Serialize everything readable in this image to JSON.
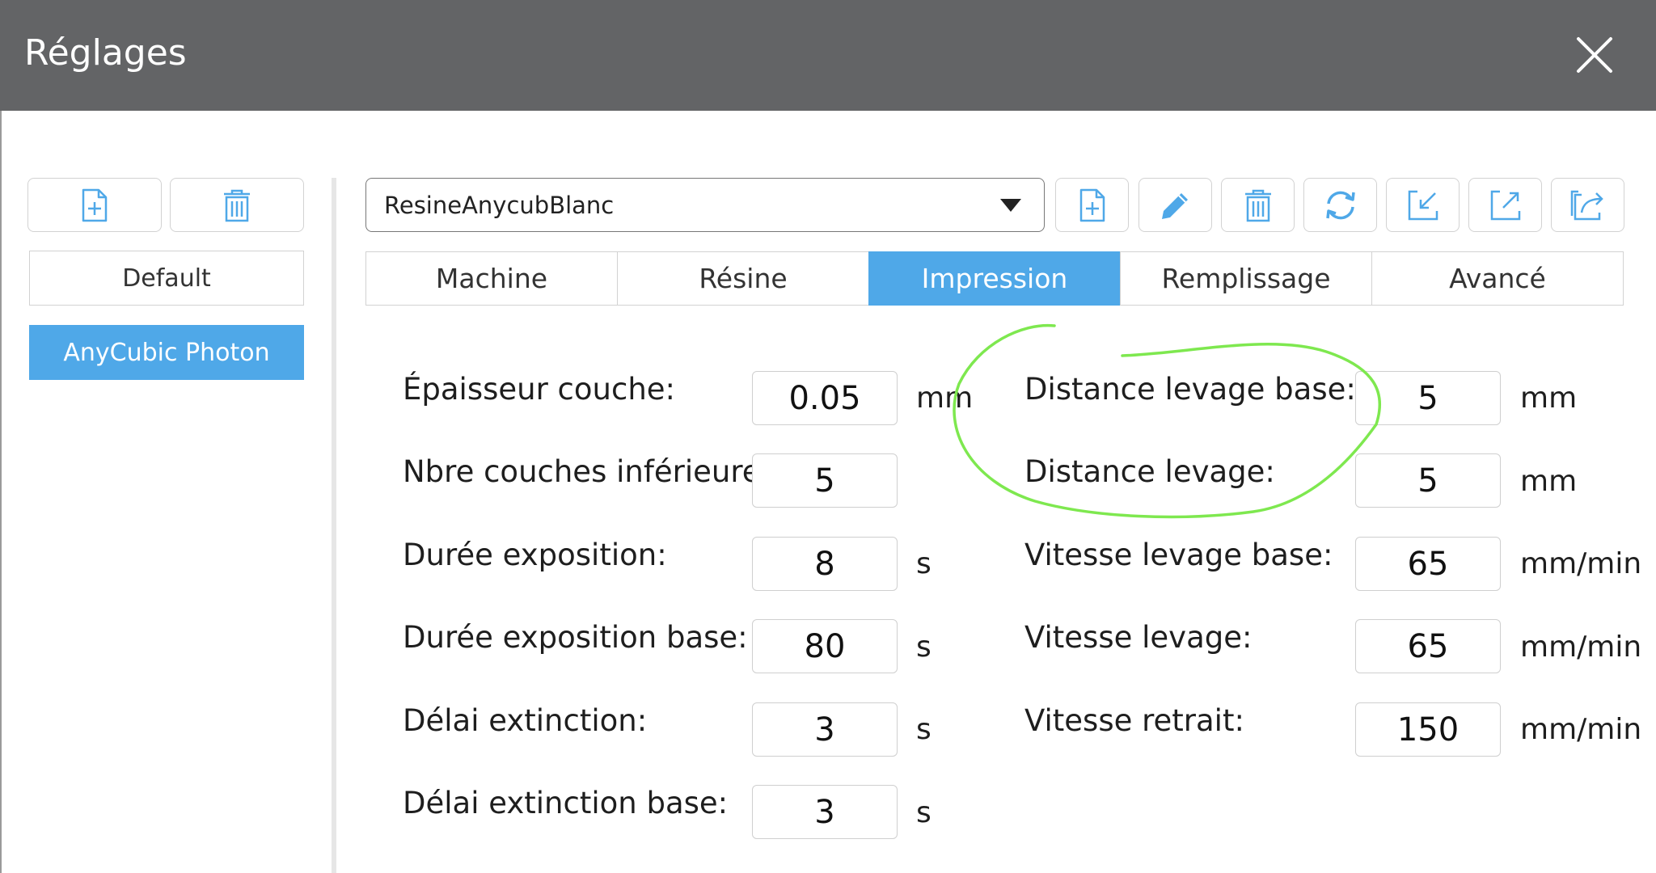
{
  "window": {
    "title": "Réglages"
  },
  "left_panel": {
    "profiles": [
      "Default",
      "AnyCubic Photon"
    ],
    "selected_profile": "AnyCubic Photon"
  },
  "resin_select": {
    "value": "ResineAnycubBlanc"
  },
  "tabs": {
    "items": [
      "Machine",
      "Résine",
      "Impression",
      "Remplissage",
      "Avancé"
    ],
    "active": "Impression"
  },
  "settings_left": [
    {
      "label": "Épaisseur couche:",
      "value": "0.05",
      "unit": "mm"
    },
    {
      "label": "Nbre couches inférieures:",
      "value": "5",
      "unit": ""
    },
    {
      "label": "Durée exposition:",
      "value": "8",
      "unit": "s"
    },
    {
      "label": "Durée exposition base:",
      "value": "80",
      "unit": "s"
    },
    {
      "label": "Délai extinction:",
      "value": "3",
      "unit": "s"
    },
    {
      "label": "Délai extinction base:",
      "value": "3",
      "unit": "s"
    }
  ],
  "settings_right": [
    {
      "label": "Distance levage base:",
      "value": "5",
      "unit": "mm"
    },
    {
      "label": "Distance levage:",
      "value": "5",
      "unit": "mm"
    },
    {
      "label": "Vitesse levage base:",
      "value": "65",
      "unit": "mm/min"
    },
    {
      "label": "Vitesse levage:",
      "value": "65",
      "unit": "mm/min"
    },
    {
      "label": "Vitesse retrait:",
      "value": "150",
      "unit": "mm/min"
    }
  ],
  "icons": {
    "profile_toolbar": [
      "new-file-icon",
      "trash-icon"
    ],
    "resin_toolbar": [
      "new-file-icon",
      "pencil-icon",
      "trash-icon",
      "refresh-icon",
      "import-icon",
      "export-icon",
      "share-icon"
    ],
    "close": "close-icon"
  },
  "colors": {
    "title_bar": "#636466",
    "accent": "#4fa8e8",
    "highlight_circle": "#7ee84f"
  }
}
